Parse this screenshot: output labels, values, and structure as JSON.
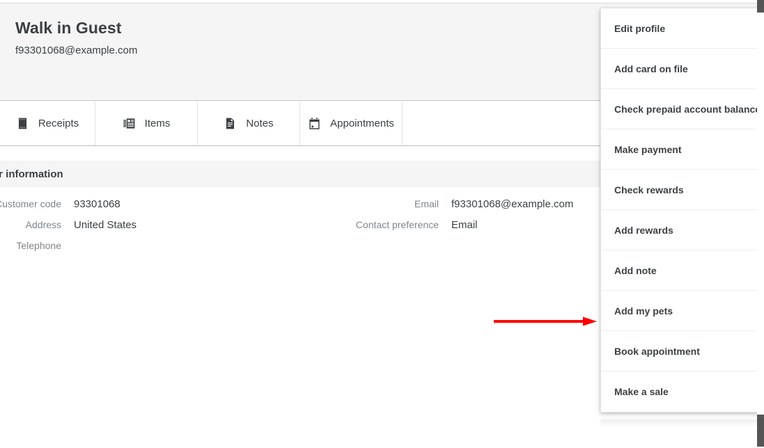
{
  "customer": {
    "name": "Walk in Guest",
    "email": "f93301068@example.com"
  },
  "tabs": [
    {
      "label": "Receipts",
      "icon": "receipt-icon"
    },
    {
      "label": "Items",
      "icon": "items-icon"
    },
    {
      "label": "Notes",
      "icon": "note-icon"
    },
    {
      "label": "Appointments",
      "icon": "calendar-icon"
    }
  ],
  "section": {
    "title": "Customer information"
  },
  "info": {
    "left": [
      {
        "label": "Customer code",
        "value": "93301068"
      },
      {
        "label": "Address",
        "value": "United States"
      },
      {
        "label": "Telephone",
        "value": ""
      }
    ],
    "right": [
      {
        "label": "Email",
        "value": "f93301068@example.com"
      },
      {
        "label": "Contact preference",
        "value": "Email"
      }
    ]
  },
  "menu": {
    "items": [
      {
        "label": "Edit profile"
      },
      {
        "label": "Add card on file"
      },
      {
        "label": "Check prepaid account balance"
      },
      {
        "label": "Make payment"
      },
      {
        "label": "Check rewards"
      },
      {
        "label": "Add rewards"
      },
      {
        "label": "Add note"
      },
      {
        "label": "Add my pets"
      },
      {
        "label": "Book appointment"
      },
      {
        "label": "Make a sale"
      }
    ]
  },
  "annotation": {
    "arrow_color": "#ff0000",
    "points_to": "Add my pets"
  },
  "colors": {
    "header_bg": "#f5f5f5",
    "text_primary": "#3c4043",
    "text_muted": "#80868b",
    "border": "#e2e2e2",
    "scrollbar_thumb": "#555555"
  }
}
